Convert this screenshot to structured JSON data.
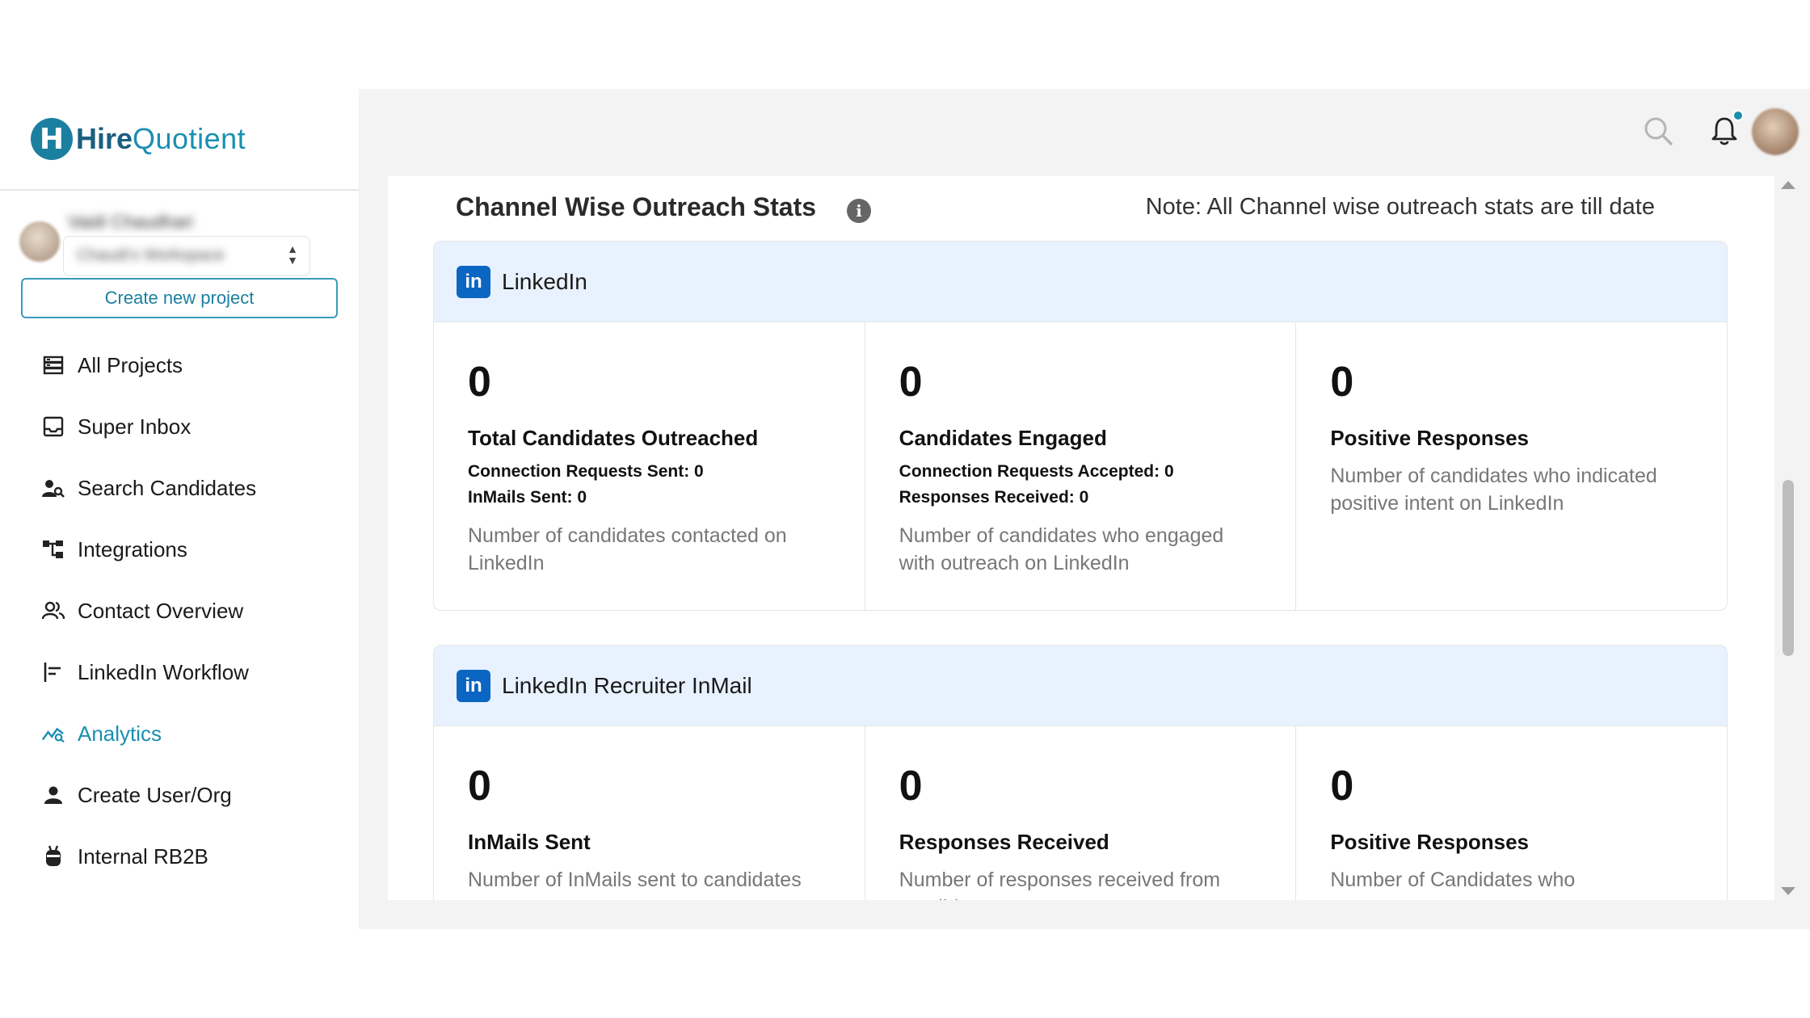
{
  "brand": {
    "hire": "Hire",
    "quotient": "Quotient",
    "mark": "H"
  },
  "user": {
    "name": "Vaidi Chaudhari",
    "workspace": "Chaudi's Workspace"
  },
  "sidebar": {
    "create_button": "Create new project",
    "items": [
      {
        "label": "All Projects",
        "icon": "projects-icon",
        "active": false
      },
      {
        "label": "Super Inbox",
        "icon": "inbox-icon",
        "active": false
      },
      {
        "label": "Search Candidates",
        "icon": "search-person-icon",
        "active": false
      },
      {
        "label": "Integrations",
        "icon": "integrations-icon",
        "active": false
      },
      {
        "label": "Contact Overview",
        "icon": "contacts-icon",
        "active": false
      },
      {
        "label": "LinkedIn Workflow",
        "icon": "workflow-icon",
        "active": false
      },
      {
        "label": "Analytics",
        "icon": "analytics-icon",
        "active": true
      },
      {
        "label": "Create User/Org",
        "icon": "user-icon",
        "active": false
      },
      {
        "label": "Internal RB2B",
        "icon": "robot-icon",
        "active": false
      }
    ]
  },
  "colors": {
    "accent": "#1b8fb0",
    "linkedin": "#0a66c2",
    "card_head": "#e8f1fe"
  },
  "section": {
    "title": "Channel Wise Outreach Stats",
    "info": "i",
    "note": "Note: All Channel wise outreach stats are till date"
  },
  "cards": [
    {
      "title": "LinkedIn",
      "badge": "in",
      "stats": [
        {
          "value": "0",
          "title": "Total Candidates Outreached",
          "sub1": "Connection Requests Sent: 0",
          "sub2": "InMails Sent: 0",
          "desc": "Number of candidates contacted on LinkedIn"
        },
        {
          "value": "0",
          "title": "Candidates Engaged",
          "sub1": "Connection Requests Accepted: 0",
          "sub2": "Responses Received: 0",
          "desc": "Number of candidates who engaged with outreach on LinkedIn"
        },
        {
          "value": "0",
          "title": "Positive Responses",
          "sub1": "",
          "sub2": "",
          "desc": "Number of candidates who indicated positive intent on LinkedIn"
        }
      ]
    },
    {
      "title": "LinkedIn Recruiter InMail",
      "badge": "in",
      "stats": [
        {
          "value": "0",
          "title": "InMails Sent",
          "sub1": "",
          "sub2": "",
          "desc": "Number of InMails sent to candidates"
        },
        {
          "value": "0",
          "title": "Responses Received",
          "sub1": "",
          "sub2": "",
          "desc": "Number of responses received from candidates"
        },
        {
          "value": "0",
          "title": "Positive Responses",
          "sub1": "",
          "sub2": "",
          "desc": "Number of Candidates who"
        }
      ]
    }
  ]
}
